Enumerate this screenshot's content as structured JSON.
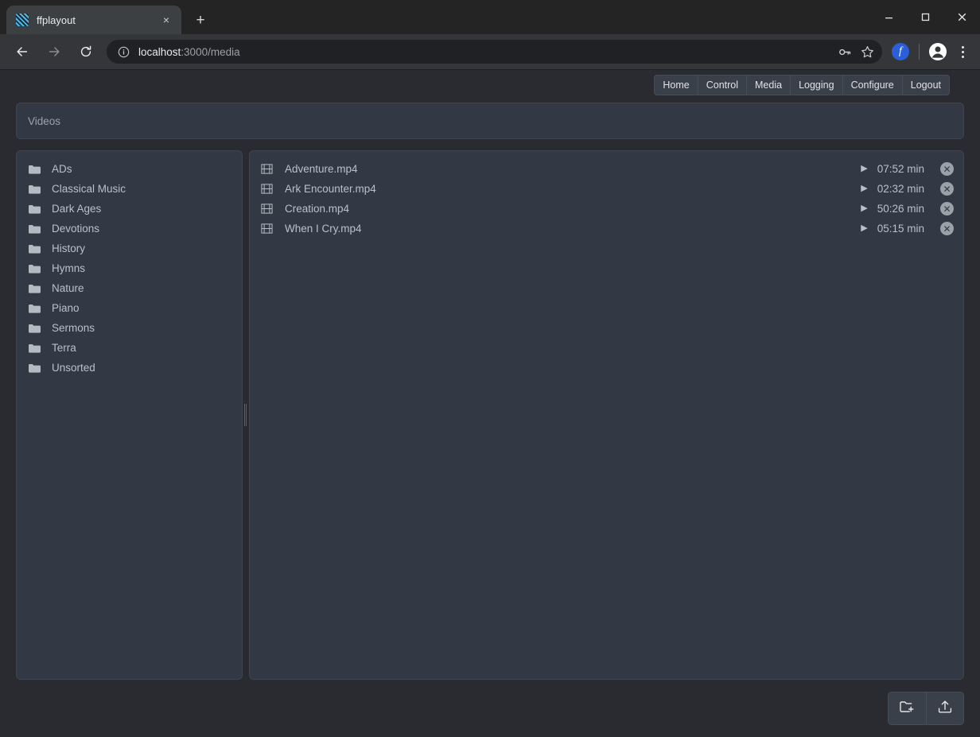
{
  "browser": {
    "tab": {
      "title": "ffplayout",
      "favicon": "ffplayout-favicon",
      "close_label": "×"
    },
    "new_tab_label": "+",
    "window_controls": {
      "minimize": "minimize-icon",
      "maximize": "maximize-icon",
      "close": "close-icon"
    },
    "nav": {
      "back": "back-arrow-icon",
      "forward": "forward-arrow-icon",
      "reload": "reload-icon"
    },
    "omnibox": {
      "info_icon": "site-info-icon",
      "url_host": "localhost",
      "url_path": ":3000/media",
      "password_icon": "key-icon",
      "bookmark_icon": "star-icon"
    },
    "extension_icon_label": "f",
    "profile_icon": "profile-avatar-icon",
    "menu_icon": "three-dot-menu-icon"
  },
  "app": {
    "nav_items": [
      {
        "label": "Home"
      },
      {
        "label": "Control"
      },
      {
        "label": "Media"
      },
      {
        "label": "Logging"
      },
      {
        "label": "Configure"
      },
      {
        "label": "Logout"
      }
    ],
    "breadcrumb": {
      "root": "Videos"
    },
    "folders": [
      {
        "name": "ADs"
      },
      {
        "name": "Classical Music"
      },
      {
        "name": "Dark Ages"
      },
      {
        "name": "Devotions"
      },
      {
        "name": "History"
      },
      {
        "name": "Hymns"
      },
      {
        "name": "Nature"
      },
      {
        "name": "Piano"
      },
      {
        "name": "Sermons"
      },
      {
        "name": "Terra"
      },
      {
        "name": "Unsorted"
      }
    ],
    "files": [
      {
        "name": "Adventure.mp4",
        "duration": "07:52 min"
      },
      {
        "name": "Ark Encounter.mp4",
        "duration": "02:32 min"
      },
      {
        "name": "Creation.mp4",
        "duration": "50:26 min"
      },
      {
        "name": "When I Cry.mp4",
        "duration": "05:15 min"
      }
    ],
    "footer_actions": [
      {
        "icon": "new-folder-icon"
      },
      {
        "icon": "upload-icon"
      }
    ],
    "colors": {
      "page_bg": "#292b30",
      "panel_bg": "#323944",
      "panel_border": "#3d4552",
      "button_bg": "#3a4049",
      "text": "#b9c0c9",
      "muted_text": "#9ba3ae",
      "favicon_accent": "#4db8e8"
    },
    "glyphs": {
      "play": "▶",
      "delete": "✕",
      "breadcrumb_sep": "/"
    }
  }
}
